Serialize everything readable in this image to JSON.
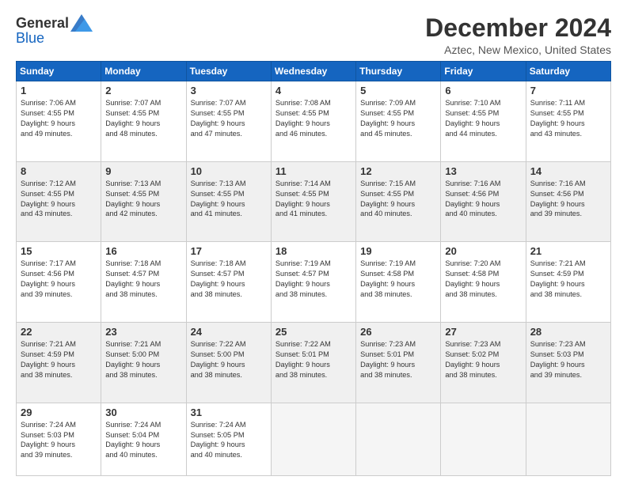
{
  "logo": {
    "general": "General",
    "blue": "Blue"
  },
  "title": "December 2024",
  "subtitle": "Aztec, New Mexico, United States",
  "days_header": [
    "Sunday",
    "Monday",
    "Tuesday",
    "Wednesday",
    "Thursday",
    "Friday",
    "Saturday"
  ],
  "weeks": [
    [
      {
        "day": "1",
        "info": "Sunrise: 7:06 AM\nSunset: 4:55 PM\nDaylight: 9 hours\nand 49 minutes."
      },
      {
        "day": "2",
        "info": "Sunrise: 7:07 AM\nSunset: 4:55 PM\nDaylight: 9 hours\nand 48 minutes."
      },
      {
        "day": "3",
        "info": "Sunrise: 7:07 AM\nSunset: 4:55 PM\nDaylight: 9 hours\nand 47 minutes."
      },
      {
        "day": "4",
        "info": "Sunrise: 7:08 AM\nSunset: 4:55 PM\nDaylight: 9 hours\nand 46 minutes."
      },
      {
        "day": "5",
        "info": "Sunrise: 7:09 AM\nSunset: 4:55 PM\nDaylight: 9 hours\nand 45 minutes."
      },
      {
        "day": "6",
        "info": "Sunrise: 7:10 AM\nSunset: 4:55 PM\nDaylight: 9 hours\nand 44 minutes."
      },
      {
        "day": "7",
        "info": "Sunrise: 7:11 AM\nSunset: 4:55 PM\nDaylight: 9 hours\nand 43 minutes."
      }
    ],
    [
      {
        "day": "8",
        "info": "Sunrise: 7:12 AM\nSunset: 4:55 PM\nDaylight: 9 hours\nand 43 minutes."
      },
      {
        "day": "9",
        "info": "Sunrise: 7:13 AM\nSunset: 4:55 PM\nDaylight: 9 hours\nand 42 minutes."
      },
      {
        "day": "10",
        "info": "Sunrise: 7:13 AM\nSunset: 4:55 PM\nDaylight: 9 hours\nand 41 minutes."
      },
      {
        "day": "11",
        "info": "Sunrise: 7:14 AM\nSunset: 4:55 PM\nDaylight: 9 hours\nand 41 minutes."
      },
      {
        "day": "12",
        "info": "Sunrise: 7:15 AM\nSunset: 4:55 PM\nDaylight: 9 hours\nand 40 minutes."
      },
      {
        "day": "13",
        "info": "Sunrise: 7:16 AM\nSunset: 4:56 PM\nDaylight: 9 hours\nand 40 minutes."
      },
      {
        "day": "14",
        "info": "Sunrise: 7:16 AM\nSunset: 4:56 PM\nDaylight: 9 hours\nand 39 minutes."
      }
    ],
    [
      {
        "day": "15",
        "info": "Sunrise: 7:17 AM\nSunset: 4:56 PM\nDaylight: 9 hours\nand 39 minutes."
      },
      {
        "day": "16",
        "info": "Sunrise: 7:18 AM\nSunset: 4:57 PM\nDaylight: 9 hours\nand 38 minutes."
      },
      {
        "day": "17",
        "info": "Sunrise: 7:18 AM\nSunset: 4:57 PM\nDaylight: 9 hours\nand 38 minutes."
      },
      {
        "day": "18",
        "info": "Sunrise: 7:19 AM\nSunset: 4:57 PM\nDaylight: 9 hours\nand 38 minutes."
      },
      {
        "day": "19",
        "info": "Sunrise: 7:19 AM\nSunset: 4:58 PM\nDaylight: 9 hours\nand 38 minutes."
      },
      {
        "day": "20",
        "info": "Sunrise: 7:20 AM\nSunset: 4:58 PM\nDaylight: 9 hours\nand 38 minutes."
      },
      {
        "day": "21",
        "info": "Sunrise: 7:21 AM\nSunset: 4:59 PM\nDaylight: 9 hours\nand 38 minutes."
      }
    ],
    [
      {
        "day": "22",
        "info": "Sunrise: 7:21 AM\nSunset: 4:59 PM\nDaylight: 9 hours\nand 38 minutes."
      },
      {
        "day": "23",
        "info": "Sunrise: 7:21 AM\nSunset: 5:00 PM\nDaylight: 9 hours\nand 38 minutes."
      },
      {
        "day": "24",
        "info": "Sunrise: 7:22 AM\nSunset: 5:00 PM\nDaylight: 9 hours\nand 38 minutes."
      },
      {
        "day": "25",
        "info": "Sunrise: 7:22 AM\nSunset: 5:01 PM\nDaylight: 9 hours\nand 38 minutes."
      },
      {
        "day": "26",
        "info": "Sunrise: 7:23 AM\nSunset: 5:01 PM\nDaylight: 9 hours\nand 38 minutes."
      },
      {
        "day": "27",
        "info": "Sunrise: 7:23 AM\nSunset: 5:02 PM\nDaylight: 9 hours\nand 38 minutes."
      },
      {
        "day": "28",
        "info": "Sunrise: 7:23 AM\nSunset: 5:03 PM\nDaylight: 9 hours\nand 39 minutes."
      }
    ],
    [
      {
        "day": "29",
        "info": "Sunrise: 7:24 AM\nSunset: 5:03 PM\nDaylight: 9 hours\nand 39 minutes."
      },
      {
        "day": "30",
        "info": "Sunrise: 7:24 AM\nSunset: 5:04 PM\nDaylight: 9 hours\nand 40 minutes."
      },
      {
        "day": "31",
        "info": "Sunrise: 7:24 AM\nSunset: 5:05 PM\nDaylight: 9 hours\nand 40 minutes."
      },
      {
        "day": "",
        "info": ""
      },
      {
        "day": "",
        "info": ""
      },
      {
        "day": "",
        "info": ""
      },
      {
        "day": "",
        "info": ""
      }
    ]
  ]
}
